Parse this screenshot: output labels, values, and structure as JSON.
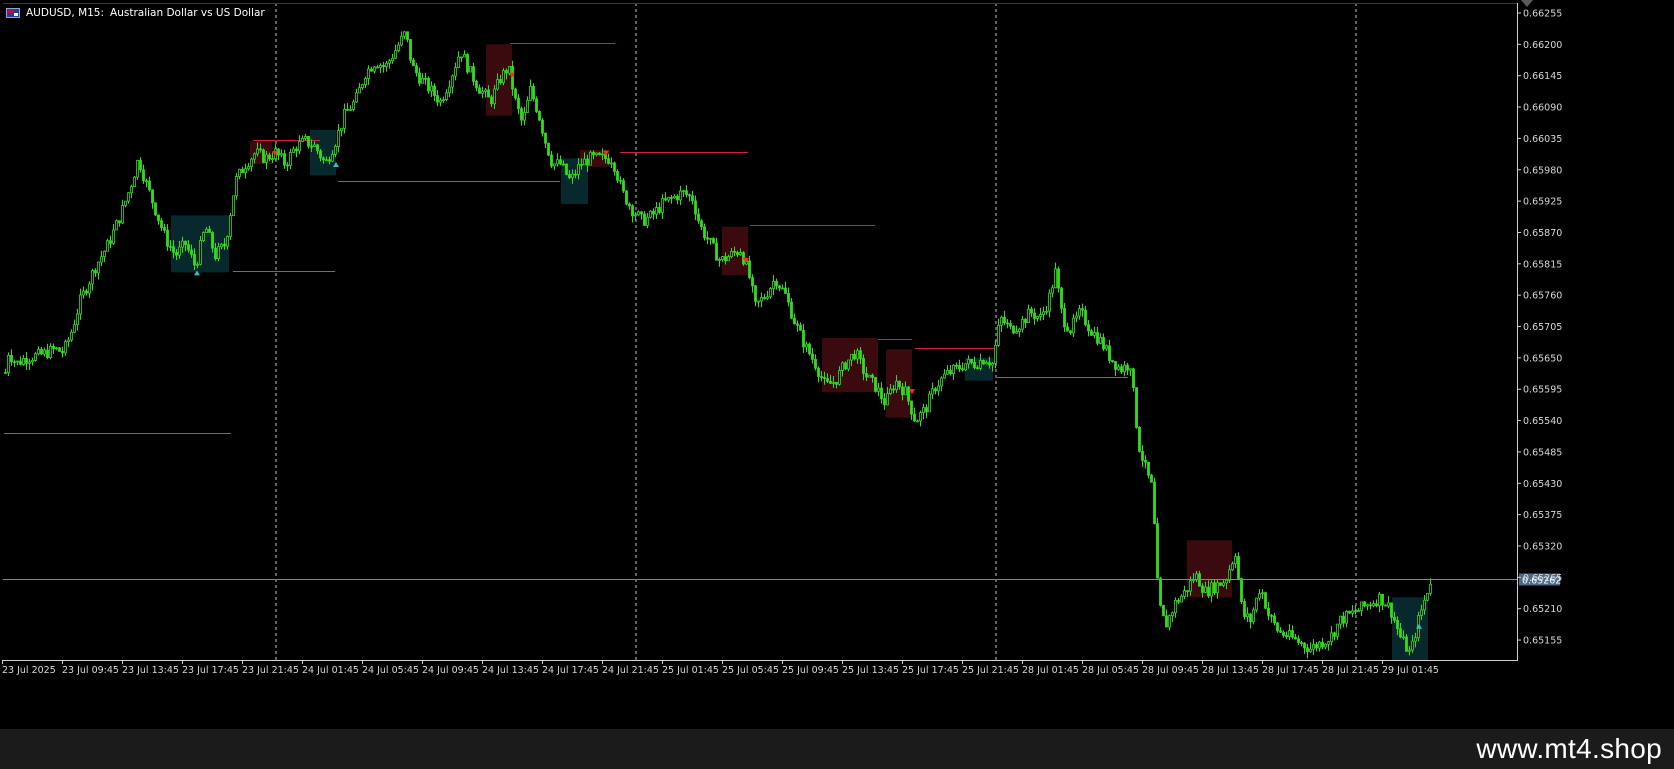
{
  "window": {
    "symbol_label": "AUDUSD, M15:",
    "symbol_description": "Australian Dollar vs US Dollar"
  },
  "watermark": {
    "text": "www.mt4.shop"
  },
  "colors": {
    "background": "#000000",
    "candle_bull": "#32dc1e",
    "candle_bear": "#32dc1e",
    "resistance_line": "#d0213a",
    "support_line": "#1f8f9a",
    "supply_zone": "#3a0a0e",
    "demand_zone": "#07282c",
    "grid_separator": "#d8d8d8",
    "axis_text": "#d8d8d8",
    "current_price_line": "#7a8a9a",
    "current_price_badge": "#4a6a88"
  },
  "chart_data": {
    "type": "candlestick",
    "timeframe": "M15",
    "y_axis": {
      "ylim": [
        0.6512,
        0.66262
      ],
      "ticks": [
        "0.66255",
        "0.66200",
        "0.66145",
        "0.66090",
        "0.66035",
        "0.65980",
        "0.65925",
        "0.65870",
        "0.65815",
        "0.65760",
        "0.65705",
        "0.65650",
        "0.65595",
        "0.65540",
        "0.65485",
        "0.65430",
        "0.65375",
        "0.65320",
        "0.65265",
        "0.65210",
        "0.65155"
      ]
    },
    "x_axis": {
      "ticks": [
        "23 Jul 2025",
        "23 Jul 09:45",
        "23 Jul 13:45",
        "23 Jul 17:45",
        "23 Jul 21:45",
        "24 Jul 01:45",
        "24 Jul 05:45",
        "24 Jul 09:45",
        "24 Jul 13:45",
        "24 Jul 17:45",
        "24 Jul 21:45",
        "25 Jul 01:45",
        "25 Jul 05:45",
        "25 Jul 09:45",
        "25 Jul 13:45",
        "25 Jul 17:45",
        "25 Jul 21:45",
        "28 Jul 01:45",
        "28 Jul 05:45",
        "28 Jul 09:45",
        "28 Jul 13:45",
        "28 Jul 17:45",
        "28 Jul 21:45",
        "29 Jul 01:45"
      ],
      "day_separators_after_tick": [
        "23 Jul 21:45",
        "24 Jul 21:45",
        "25 Jul 21:45",
        "28 Jul 21:45"
      ]
    },
    "current_price": "0.65262",
    "price_path": [
      [
        0,
        0.65565
      ],
      [
        8,
        0.6566
      ],
      [
        16,
        0.6564
      ],
      [
        25,
        0.6565
      ],
      [
        40,
        0.65655
      ],
      [
        55,
        0.65665
      ],
      [
        63,
        0.6566
      ],
      [
        70,
        0.6569
      ],
      [
        80,
        0.6575
      ],
      [
        95,
        0.6581
      ],
      [
        108,
        0.6585
      ],
      [
        120,
        0.659
      ],
      [
        130,
        0.6595
      ],
      [
        138,
        0.66
      ],
      [
        145,
        0.6596
      ],
      [
        155,
        0.6591
      ],
      [
        165,
        0.6586
      ],
      [
        175,
        0.6583
      ],
      [
        185,
        0.6585
      ],
      [
        195,
        0.6581
      ],
      [
        205,
        0.6588
      ],
      [
        215,
        0.6583
      ],
      [
        225,
        0.6585
      ],
      [
        235,
        0.6596
      ],
      [
        245,
        0.6599
      ],
      [
        255,
        0.6601
      ],
      [
        265,
        0.66
      ],
      [
        275,
        0.6601
      ],
      [
        285,
        0.6599
      ],
      [
        295,
        0.6602
      ],
      [
        305,
        0.6603
      ],
      [
        315,
        0.6602
      ],
      [
        325,
        0.6599
      ],
      [
        335,
        0.6603
      ],
      [
        345,
        0.6608
      ],
      [
        355,
        0.661
      ],
      [
        365,
        0.6615
      ],
      [
        375,
        0.6617
      ],
      [
        385,
        0.6616
      ],
      [
        395,
        0.6619
      ],
      [
        405,
        0.6622
      ],
      [
        412,
        0.6616
      ],
      [
        420,
        0.6614
      ],
      [
        430,
        0.6612
      ],
      [
        440,
        0.661
      ],
      [
        450,
        0.6614
      ],
      [
        460,
        0.6619
      ],
      [
        470,
        0.6615
      ],
      [
        480,
        0.6612
      ],
      [
        490,
        0.661
      ],
      [
        500,
        0.6614
      ],
      [
        508,
        0.6616
      ],
      [
        515,
        0.661
      ],
      [
        522,
        0.6606
      ],
      [
        530,
        0.6612
      ],
      [
        538,
        0.6608
      ],
      [
        545,
        0.6603
      ],
      [
        552,
        0.6599
      ],
      [
        560,
        0.6599
      ],
      [
        570,
        0.6596
      ],
      [
        580,
        0.6599
      ],
      [
        590,
        0.66
      ],
      [
        600,
        0.66
      ],
      [
        612,
        0.66
      ],
      [
        622,
        0.6594
      ],
      [
        632,
        0.6591
      ],
      [
        642,
        0.6589
      ],
      [
        652,
        0.659
      ],
      [
        662,
        0.6592
      ],
      [
        672,
        0.6593
      ],
      [
        682,
        0.6594
      ],
      [
        692,
        0.6593
      ],
      [
        700,
        0.6588
      ],
      [
        710,
        0.6585
      ],
      [
        720,
        0.6582
      ],
      [
        730,
        0.6583
      ],
      [
        740,
        0.6584
      ],
      [
        748,
        0.658
      ],
      [
        755,
        0.6574
      ],
      [
        765,
        0.6576
      ],
      [
        775,
        0.6579
      ],
      [
        785,
        0.6576
      ],
      [
        795,
        0.6571
      ],
      [
        805,
        0.6567
      ],
      [
        815,
        0.6564
      ],
      [
        825,
        0.656
      ],
      [
        835,
        0.6561
      ],
      [
        845,
        0.6564
      ],
      [
        855,
        0.6566
      ],
      [
        865,
        0.6562
      ],
      [
        875,
        0.656
      ],
      [
        885,
        0.6557
      ],
      [
        895,
        0.6561
      ],
      [
        905,
        0.6559
      ],
      [
        915,
        0.6554
      ],
      [
        925,
        0.6556
      ],
      [
        935,
        0.656
      ],
      [
        945,
        0.6562
      ],
      [
        955,
        0.6563
      ],
      [
        965,
        0.6564
      ],
      [
        975,
        0.6564
      ],
      [
        985,
        0.6565
      ],
      [
        992,
        0.6564
      ],
      [
        1000,
        0.6572
      ],
      [
        1010,
        0.657
      ],
      [
        1020,
        0.6571
      ],
      [
        1030,
        0.6573
      ],
      [
        1040,
        0.6572
      ],
      [
        1048,
        0.6575
      ],
      [
        1055,
        0.658
      ],
      [
        1062,
        0.6572
      ],
      [
        1070,
        0.657
      ],
      [
        1080,
        0.6573
      ],
      [
        1090,
        0.657
      ],
      [
        1100,
        0.6568
      ],
      [
        1110,
        0.6565
      ],
      [
        1120,
        0.6563
      ],
      [
        1130,
        0.6564
      ],
      [
        1138,
        0.655
      ],
      [
        1146,
        0.6545
      ],
      [
        1152,
        0.6542
      ],
      [
        1158,
        0.6522
      ],
      [
        1165,
        0.6518
      ],
      [
        1175,
        0.6522
      ],
      [
        1185,
        0.6524
      ],
      [
        1195,
        0.6527
      ],
      [
        1205,
        0.6524
      ],
      [
        1215,
        0.6525
      ],
      [
        1225,
        0.6526
      ],
      [
        1235,
        0.6531
      ],
      [
        1242,
        0.652
      ],
      [
        1250,
        0.6519
      ],
      [
        1260,
        0.6525
      ],
      [
        1268,
        0.652
      ],
      [
        1278,
        0.6517
      ],
      [
        1290,
        0.6516
      ],
      [
        1300,
        0.6515
      ],
      [
        1310,
        0.6514
      ],
      [
        1320,
        0.6515
      ],
      [
        1330,
        0.6516
      ],
      [
        1340,
        0.6519
      ],
      [
        1350,
        0.652
      ],
      [
        1360,
        0.6521
      ],
      [
        1370,
        0.6522
      ],
      [
        1380,
        0.6523
      ],
      [
        1390,
        0.6521
      ],
      [
        1400,
        0.6516
      ],
      [
        1410,
        0.6513
      ],
      [
        1418,
        0.6519
      ],
      [
        1425,
        0.6523
      ],
      [
        1430,
        0.6526
      ]
    ],
    "resistance_lines": [
      {
        "x1": 510,
        "x2": 615,
        "price": 0.66203
      },
      {
        "x1": 253,
        "x2": 320,
        "price": 0.66033
      },
      {
        "x1": 620,
        "x2": 748,
        "price": 0.66012
      },
      {
        "x1": 750,
        "x2": 875,
        "price": 0.65883
      },
      {
        "x1": 878,
        "x2": 912,
        "price": 0.65683
      },
      {
        "x1": 915,
        "x2": 995,
        "price": 0.65668
      }
    ],
    "support_lines": [
      {
        "x1": 4,
        "x2": 231,
        "price": 0.65518
      },
      {
        "x1": 233,
        "x2": 335,
        "price": 0.65803
      },
      {
        "x1": 338,
        "x2": 560,
        "price": 0.65961
      },
      {
        "x1": 997,
        "x2": 1128,
        "price": 0.65616
      }
    ],
    "supply_zones": [
      {
        "x1": 250,
        "x2": 272,
        "p1": 0.6603,
        "p2": 0.6599
      },
      {
        "x1": 486,
        "x2": 512,
        "p1": 0.662,
        "p2": 0.66075
      },
      {
        "x1": 580,
        "x2": 610,
        "p1": 0.66015,
        "p2": 0.65985
      },
      {
        "x1": 722,
        "x2": 748,
        "p1": 0.6588,
        "p2": 0.65795
      },
      {
        "x1": 822,
        "x2": 878,
        "p1": 0.65685,
        "p2": 0.6559
      },
      {
        "x1": 886,
        "x2": 912,
        "p1": 0.65665,
        "p2": 0.65545
      },
      {
        "x1": 1187,
        "x2": 1232,
        "p1": 0.6533,
        "p2": 0.6523
      }
    ],
    "demand_zones": [
      {
        "x1": 171,
        "x2": 229,
        "p1": 0.659,
        "p2": 0.658
      },
      {
        "x1": 310,
        "x2": 336,
        "p1": 0.6605,
        "p2": 0.6597
      },
      {
        "x1": 561,
        "x2": 588,
        "p1": 0.66,
        "p2": 0.6592
      },
      {
        "x1": 965,
        "x2": 993,
        "p1": 0.6565,
        "p2": 0.6561
      },
      {
        "x1": 1392,
        "x2": 1428,
        "p1": 0.6523,
        "p2": 0.6512
      }
    ],
    "signal_arrows": [
      {
        "x": 275,
        "price": 0.66008,
        "dir": "down"
      },
      {
        "x": 512,
        "price": 0.66145,
        "dir": "down"
      },
      {
        "x": 606,
        "price": 0.66008,
        "dir": "down"
      },
      {
        "x": 746,
        "price": 0.6582,
        "dir": "down"
      },
      {
        "x": 912,
        "price": 0.6559,
        "dir": "down"
      },
      {
        "x": 197,
        "price": 0.658,
        "dir": "up"
      },
      {
        "x": 336,
        "price": 0.6599,
        "dir": "up"
      },
      {
        "x": 1419,
        "price": 0.6518,
        "dir": "up"
      }
    ]
  }
}
